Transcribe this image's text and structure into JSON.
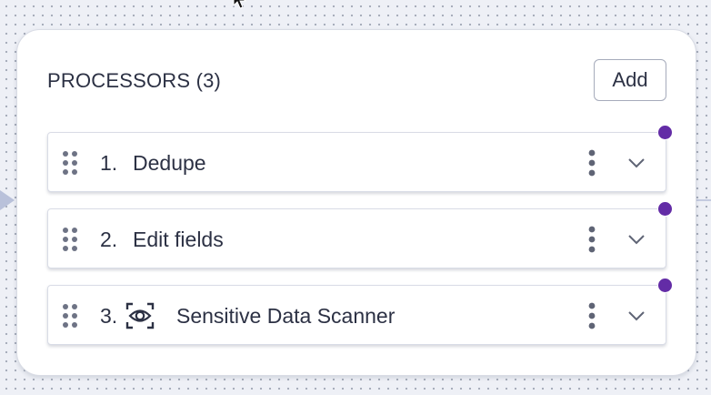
{
  "panel": {
    "title": "PROCESSORS (3)",
    "add_label": "Add"
  },
  "processors": [
    {
      "number": "1.",
      "name": "Dedupe",
      "icon": ""
    },
    {
      "number": "2.",
      "name": "Edit fields",
      "icon": ""
    },
    {
      "number": "3.",
      "name": "Sensitive Data Scanner",
      "icon": "eye-scan-icon"
    }
  ],
  "colors": {
    "status_dot": "#632ca6",
    "text": "#2c3144",
    "canvas": "#eef0f6"
  }
}
